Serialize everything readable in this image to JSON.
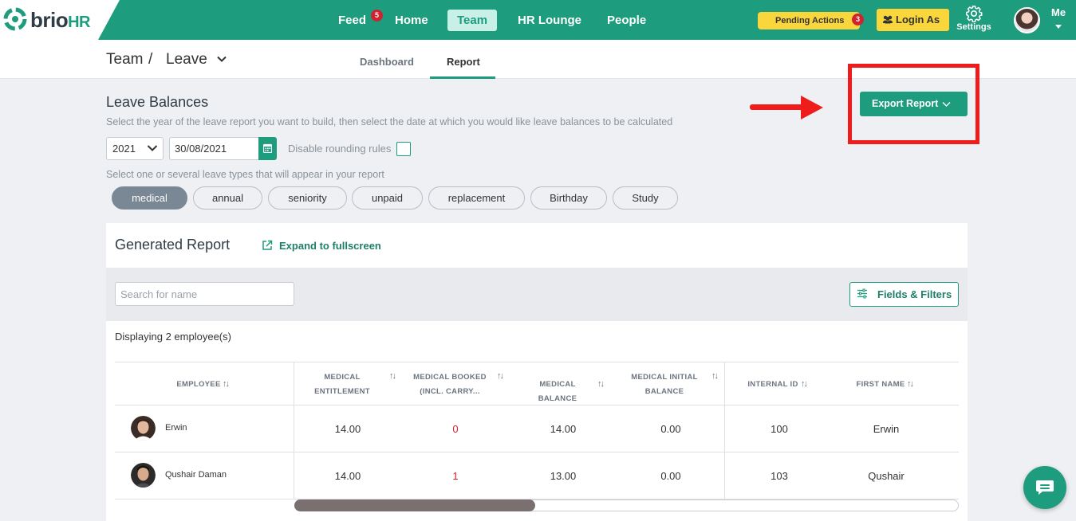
{
  "brand": {
    "name": "brio",
    "suffix": "HR"
  },
  "topnav": {
    "items": [
      {
        "label": "Feed",
        "badge": "5"
      },
      {
        "label": "Home"
      },
      {
        "label": "Team"
      },
      {
        "label": "HR Lounge"
      },
      {
        "label": "People"
      }
    ],
    "pending_label": "Pending Actions",
    "pending_badge": "3",
    "login_as_label": "Login As",
    "settings_label": "Settings",
    "me_label": "Me"
  },
  "breadcrumb": {
    "section": "Team",
    "separator": "/",
    "page": "Leave"
  },
  "subtabs": [
    {
      "label": "Dashboard"
    },
    {
      "label": "Report"
    }
  ],
  "leave_balances": {
    "title": "Leave Balances",
    "description": "Select the year of the leave report you want to build, then select the date at which you would like leave balances to be calculated",
    "year": "2021",
    "date": "30/08/2021",
    "rounding_label": "Disable rounding rules",
    "types_description": "Select one or several leave types that will appear in your report",
    "types": [
      "medical",
      "annual",
      "seniority",
      "unpaid",
      "replacement",
      "Birthday",
      "Study"
    ],
    "selected_type": "medical"
  },
  "export_label": "Export Report",
  "report": {
    "title": "Generated Report",
    "expand_label": "Expand to fullscreen",
    "search_placeholder": "Search for name",
    "fields_label": "Fields & Filters",
    "display_count": "Displaying 2 employee(s)",
    "columns": [
      {
        "line1": "EMPLOYEE",
        "line2": ""
      },
      {
        "line1": "MEDICAL",
        "line2": "ENTITLEMENT"
      },
      {
        "line1": "MEDICAL BOOKED",
        "line2": "(INCL. CARRY..."
      },
      {
        "line1": "MEDICAL BALANCE",
        "line2": ""
      },
      {
        "line1": "MEDICAL INITIAL",
        "line2": "BALANCE"
      },
      {
        "line1": "INTERNAL ID",
        "line2": ""
      },
      {
        "line1": "FIRST NAME",
        "line2": ""
      }
    ],
    "sort_glyph": "↑↓",
    "rows": [
      {
        "name": "Erwin",
        "entitlement": "14.00",
        "booked": "0",
        "balance": "14.00",
        "initial": "0.00",
        "internal_id": "100",
        "first_name": "Erwin"
      },
      {
        "name": "Qushair Daman",
        "entitlement": "14.00",
        "booked": "1",
        "balance": "13.00",
        "initial": "0.00",
        "internal_id": "103",
        "first_name": "Qushair"
      }
    ]
  },
  "colors": {
    "brand_green": "#1e9c7e",
    "badge_red": "#d0222f",
    "yellow": "#f9d63c",
    "annotation_red": "#ef1c1c"
  }
}
